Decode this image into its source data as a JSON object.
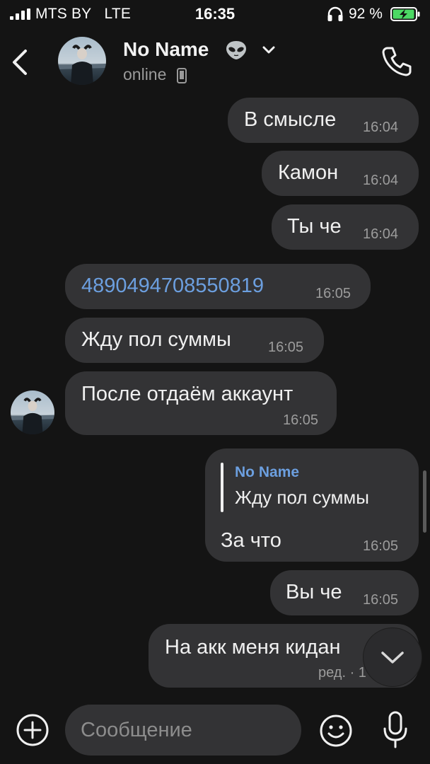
{
  "status_bar": {
    "carrier": "MTS BY",
    "network": "LTE",
    "time": "16:35",
    "battery_percent": "92 %",
    "battery_color": "#4cd964"
  },
  "header": {
    "back_icon": "chevron-left-icon",
    "contact_name": "No Name",
    "contact_emoji": "alien-icon",
    "status": "online",
    "call_icon": "phone-icon"
  },
  "messages": [
    {
      "direction": "out",
      "text": "В смысле",
      "time": "16:04"
    },
    {
      "direction": "out",
      "text": "Камон",
      "time": "16:04"
    },
    {
      "direction": "out",
      "text": "Ты че",
      "time": "16:04"
    },
    {
      "direction": "in",
      "text": "4890494708550819",
      "time": "16:05",
      "is_link": true
    },
    {
      "direction": "in",
      "text": "Жду пол суммы",
      "time": "16:05"
    },
    {
      "direction": "in",
      "text": "После отдаём аккаунт",
      "time": "16:05"
    },
    {
      "direction": "out",
      "reply_to": {
        "author": "No Name",
        "text": "Жду пол суммы"
      },
      "text": "За что",
      "time": "16:05"
    },
    {
      "direction": "out",
      "text": "Вы че",
      "time": "16:05"
    },
    {
      "direction": "out",
      "text": "На акк меня кидан",
      "time": "ред. · 1",
      "edited": true
    }
  ],
  "composer": {
    "placeholder": "Сообщение",
    "attach_icon": "plus-circle-icon",
    "emoji_icon": "smiley-icon",
    "mic_icon": "microphone-icon"
  },
  "colors": {
    "background": "#141414",
    "bubble": "#333335",
    "link": "#6c9fdf"
  }
}
